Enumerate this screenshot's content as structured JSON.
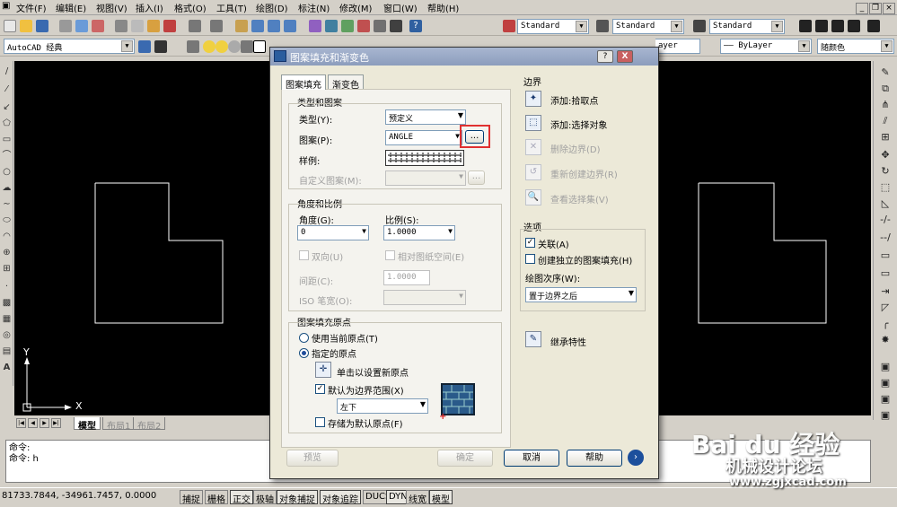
{
  "menu": [
    "文件(F)",
    "编辑(E)",
    "视图(V)",
    "插入(I)",
    "格式(O)",
    "工具(T)",
    "绘图(D)",
    "标注(N)",
    "修改(M)",
    "窗口(W)",
    "帮助(H)"
  ],
  "toolbar": {
    "text_style": "Standard",
    "dim_style": "Standard",
    "table_style": "Standard",
    "workspace": "AutoCAD 经典",
    "layer_value": "ayer",
    "linetype": "—— ByLayer",
    "color": "随颜色"
  },
  "ucs": {
    "y_label": "Y",
    "x_label": "X"
  },
  "layout_tabs": [
    "模型",
    "布局1",
    "布局2"
  ],
  "command": {
    "line1": "命令:",
    "line2": "命令: h"
  },
  "status": {
    "coords": "81733.7844,  -34961.7457, 0.0000",
    "toggles": [
      "捕捉",
      "栅格",
      "正交",
      "极轴",
      "对象捕捉",
      "对象追踪",
      "DUCS",
      "DYN",
      "线宽",
      "模型"
    ]
  },
  "dialog": {
    "title": "图案填充和渐变色",
    "help_btn": "?",
    "close_btn": "X",
    "tabs": [
      "图案填充",
      "渐变色"
    ],
    "type_pattern": {
      "heading": "类型和图案",
      "type_label": "类型(Y):",
      "type_value": "预定义",
      "pattern_label": "图案(P):",
      "pattern_value": "ANGLE",
      "browse_btn": "...",
      "sample_label": "样例:",
      "custom_label": "自定义图案(M):"
    },
    "angle_scale": {
      "heading": "角度和比例",
      "angle_label": "角度(G):",
      "angle_value": "0",
      "scale_label": "比例(S):",
      "scale_value": "1.0000",
      "double_label": "双向(U)",
      "relative_label": "相对图纸空间(E)",
      "spacing_label": "间距(C):",
      "spacing_value": "1.0000",
      "iso_label": "ISO 笔宽(O):"
    },
    "origin": {
      "heading": "图案填充原点",
      "use_current": "使用当前原点(T)",
      "specified": "指定的原点",
      "click_set": "单击以设置新原点",
      "default_extent": "默认为边界范围(X)",
      "extent_value": "左下",
      "store_default": "存储为默认原点(F)"
    },
    "boundary": {
      "heading": "边界",
      "add_pick": "添加:拾取点",
      "add_select": "添加:选择对象",
      "remove": "删除边界(D)",
      "recreate": "重新创建边界(R)",
      "view_sel": "查看选择集(V)"
    },
    "options": {
      "heading": "选项",
      "associative": "关联(A)",
      "separate": "创建独立的图案填充(H)",
      "draw_order_label": "绘图次序(W):",
      "draw_order_value": "置于边界之后"
    },
    "inherit": "继承特性",
    "buttons": {
      "preview": "预览",
      "ok": "确定",
      "cancel": "取消",
      "help": "帮助"
    }
  },
  "watermark": {
    "brand": "Bai du 经验",
    "site_name": "机械设计论坛",
    "url": "www.zgjxcad.com"
  }
}
